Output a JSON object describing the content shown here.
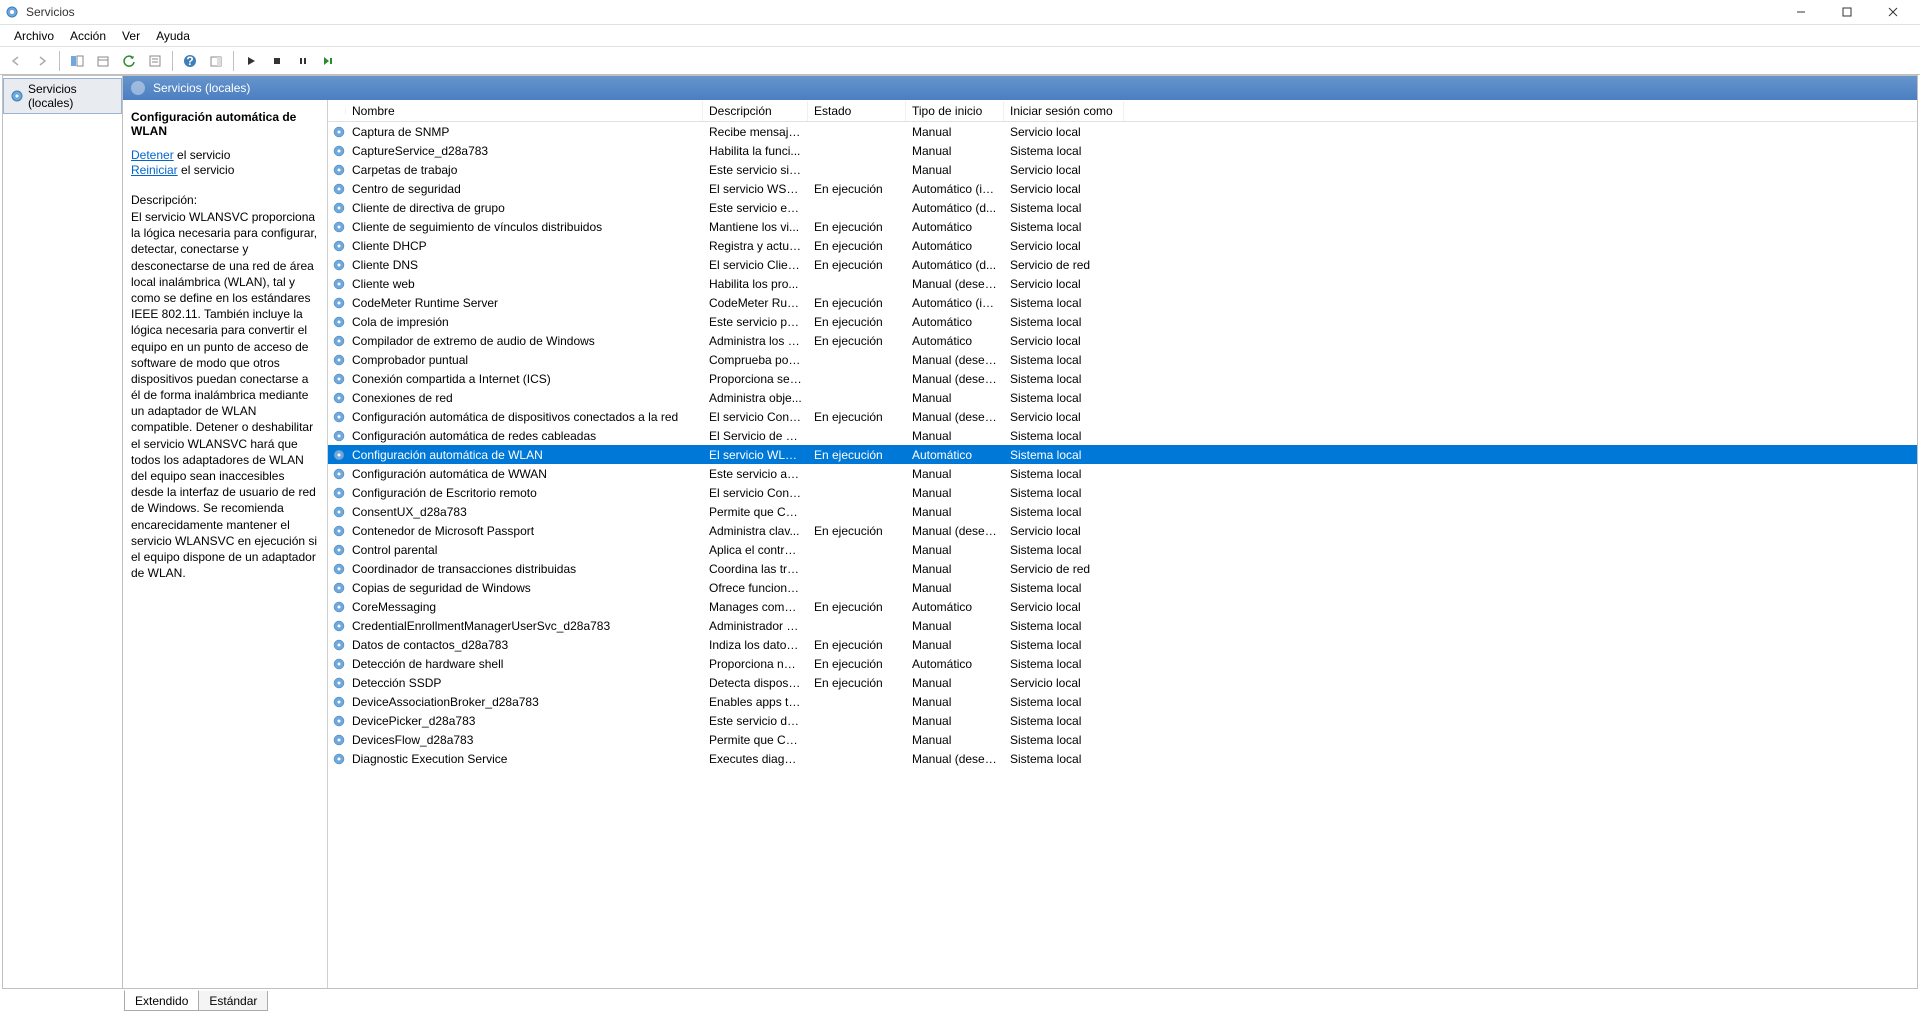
{
  "window": {
    "title": "Servicios"
  },
  "menu": {
    "items": [
      "Archivo",
      "Acción",
      "Ver",
      "Ayuda"
    ]
  },
  "tree": {
    "root": "Servicios (locales)"
  },
  "contentHeader": "Servicios (locales)",
  "details": {
    "selectedName": "Configuración automática de WLAN",
    "links": [
      {
        "action": "Detener",
        "suffix": " el servicio"
      },
      {
        "action": "Reiniciar",
        "suffix": " el servicio"
      }
    ],
    "descLabel": "Descripción:",
    "descText": "El servicio WLANSVC proporciona la lógica necesaria para configurar, detectar, conectarse y desconectarse de una red de área local inalámbrica (WLAN), tal y como se define en los estándares IEEE 802.11. También incluye la lógica necesaria para convertir el equipo en un punto de acceso de software de modo que otros dispositivos puedan conectarse a él de forma inalámbrica mediante un adaptador de WLAN compatible. Detener o deshabilitar el servicio WLANSVC hará que todos los adaptadores de WLAN del equipo sean inaccesibles desde la interfaz de usuario de red de Windows. Se recomienda encarecidamente mantener el servicio WLANSVC en ejecución si el equipo dispone de un adaptador de WLAN."
  },
  "columns": [
    "Nombre",
    "Descripción",
    "Estado",
    "Tipo de inicio",
    "Iniciar sesión como"
  ],
  "rows": [
    {
      "name": "Captura de SNMP",
      "desc": "Recibe mensaje...",
      "estado": "",
      "tipo": "Manual",
      "logon": "Servicio local"
    },
    {
      "name": "CaptureService_d28a783",
      "desc": "Habilita la funci...",
      "estado": "",
      "tipo": "Manual",
      "logon": "Sistema local"
    },
    {
      "name": "Carpetas de trabajo",
      "desc": "Este servicio sin...",
      "estado": "",
      "tipo": "Manual",
      "logon": "Servicio local"
    },
    {
      "name": "Centro de seguridad",
      "desc": "El servicio WSCS...",
      "estado": "En ejecución",
      "tipo": "Automático (in...",
      "logon": "Servicio local"
    },
    {
      "name": "Cliente de directiva de grupo",
      "desc": "Este servicio es r...",
      "estado": "",
      "tipo": "Automático (d...",
      "logon": "Sistema local"
    },
    {
      "name": "Cliente de seguimiento de vínculos distribuidos",
      "desc": "Mantiene los vi...",
      "estado": "En ejecución",
      "tipo": "Automático",
      "logon": "Sistema local"
    },
    {
      "name": "Cliente DHCP",
      "desc": "Registra y actua...",
      "estado": "En ejecución",
      "tipo": "Automático",
      "logon": "Servicio local"
    },
    {
      "name": "Cliente DNS",
      "desc": "El servicio Client...",
      "estado": "En ejecución",
      "tipo": "Automático (d...",
      "logon": "Servicio de red"
    },
    {
      "name": "Cliente web",
      "desc": "Habilita los pro...",
      "estado": "",
      "tipo": "Manual (desen...",
      "logon": "Servicio local"
    },
    {
      "name": "CodeMeter Runtime Server",
      "desc": "CodeMeter Run...",
      "estado": "En ejecución",
      "tipo": "Automático (in...",
      "logon": "Sistema local"
    },
    {
      "name": "Cola de impresión",
      "desc": "Este servicio po...",
      "estado": "En ejecución",
      "tipo": "Automático",
      "logon": "Sistema local"
    },
    {
      "name": "Compilador de extremo de audio de Windows",
      "desc": "Administra los d...",
      "estado": "En ejecución",
      "tipo": "Automático",
      "logon": "Servicio local"
    },
    {
      "name": "Comprobador puntual",
      "desc": "Comprueba pos...",
      "estado": "",
      "tipo": "Manual (desen...",
      "logon": "Sistema local"
    },
    {
      "name": "Conexión compartida a Internet (ICS)",
      "desc": "Proporciona ser...",
      "estado": "",
      "tipo": "Manual (desen...",
      "logon": "Sistema local"
    },
    {
      "name": "Conexiones de red",
      "desc": "Administra obje...",
      "estado": "",
      "tipo": "Manual",
      "logon": "Sistema local"
    },
    {
      "name": "Configuración automática de dispositivos conectados a la red",
      "desc": "El servicio Confi...",
      "estado": "En ejecución",
      "tipo": "Manual (desen...",
      "logon": "Servicio local"
    },
    {
      "name": "Configuración automática de redes cableadas",
      "desc": "El Servicio de co...",
      "estado": "",
      "tipo": "Manual",
      "logon": "Sistema local"
    },
    {
      "name": "Configuración automática de WLAN",
      "desc": "El servicio WLA...",
      "estado": "En ejecución",
      "tipo": "Automático",
      "logon": "Sistema local",
      "selected": true
    },
    {
      "name": "Configuración automática de WWAN",
      "desc": "Este servicio ad...",
      "estado": "",
      "tipo": "Manual",
      "logon": "Sistema local"
    },
    {
      "name": "Configuración de Escritorio remoto",
      "desc": "El servicio Confi...",
      "estado": "",
      "tipo": "Manual",
      "logon": "Sistema local"
    },
    {
      "name": "ConsentUX_d28a783",
      "desc": "Permite que Co...",
      "estado": "",
      "tipo": "Manual",
      "logon": "Sistema local"
    },
    {
      "name": "Contenedor de Microsoft Passport",
      "desc": "Administra clav...",
      "estado": "En ejecución",
      "tipo": "Manual (desen...",
      "logon": "Servicio local"
    },
    {
      "name": "Control parental",
      "desc": "Aplica el control...",
      "estado": "",
      "tipo": "Manual",
      "logon": "Sistema local"
    },
    {
      "name": "Coordinador de transacciones distribuidas",
      "desc": "Coordina las tra...",
      "estado": "",
      "tipo": "Manual",
      "logon": "Servicio de red"
    },
    {
      "name": "Copias de seguridad de Windows",
      "desc": "Ofrece funciona...",
      "estado": "",
      "tipo": "Manual",
      "logon": "Sistema local"
    },
    {
      "name": "CoreMessaging",
      "desc": "Manages comm...",
      "estado": "En ejecución",
      "tipo": "Automático",
      "logon": "Servicio local"
    },
    {
      "name": "CredentialEnrollmentManagerUserSvc_d28a783",
      "desc": "Administrador d...",
      "estado": "",
      "tipo": "Manual",
      "logon": "Sistema local"
    },
    {
      "name": "Datos de contactos_d28a783",
      "desc": "Indiza los datos ...",
      "estado": "En ejecución",
      "tipo": "Manual",
      "logon": "Sistema local"
    },
    {
      "name": "Detección de hardware shell",
      "desc": "Proporciona not...",
      "estado": "En ejecución",
      "tipo": "Automático",
      "logon": "Sistema local"
    },
    {
      "name": "Detección SSDP",
      "desc": "Detecta disposit...",
      "estado": "En ejecución",
      "tipo": "Manual",
      "logon": "Servicio local"
    },
    {
      "name": "DeviceAssociationBroker_d28a783",
      "desc": "Enables apps to...",
      "estado": "",
      "tipo": "Manual",
      "logon": "Sistema local"
    },
    {
      "name": "DevicePicker_d28a783",
      "desc": "Este servicio de ...",
      "estado": "",
      "tipo": "Manual",
      "logon": "Sistema local"
    },
    {
      "name": "DevicesFlow_d28a783",
      "desc": "Permite que Co...",
      "estado": "",
      "tipo": "Manual",
      "logon": "Sistema local"
    },
    {
      "name": "Diagnostic Execution Service",
      "desc": "Executes diagno...",
      "estado": "",
      "tipo": "Manual (desen...",
      "logon": "Sistema local"
    }
  ],
  "tabs": {
    "extended": "Extendido",
    "standard": "Estándar"
  }
}
